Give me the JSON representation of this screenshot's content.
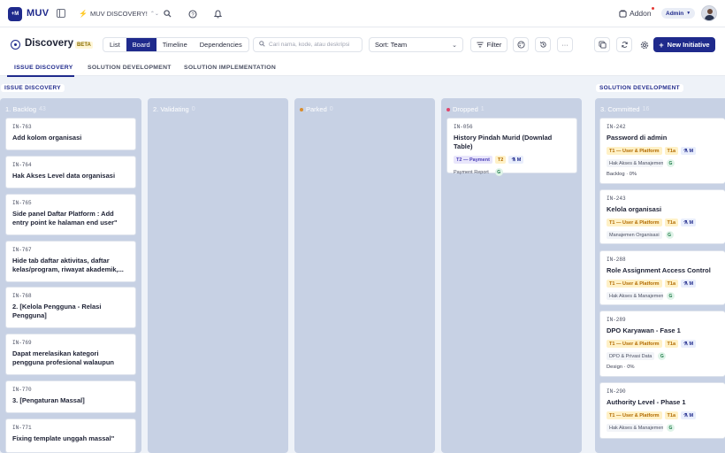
{
  "app": {
    "logo_mark": "+M",
    "logo_text": "MUV",
    "workspace": "MUV DISCOVERY!",
    "addon_label": "Addon",
    "role": "Admin"
  },
  "header": {
    "title": "Discovery",
    "badge": "BETA",
    "views": [
      "List",
      "Board",
      "Timeline",
      "Dependencies"
    ],
    "active_view": "Board",
    "search_placeholder": "Cari nama, kode, atau deskripsi",
    "sort_label": "Sort: Team",
    "filter_label": "Filter",
    "new_label": "New Initiative"
  },
  "tabs": [
    "ISSUE DISCOVERY",
    "SOLUTION DEVELOPMENT",
    "SOLUTION IMPLEMENTATION"
  ],
  "sections": {
    "issue_discovery": "ISSUE DISCOVERY",
    "solution_development": "SOLUTION DEVELOPMENT"
  },
  "columns": [
    {
      "name": "1. Backlog",
      "count": "43",
      "cards": [
        {
          "id": "IN-763",
          "title": "Add kolom organisasi"
        },
        {
          "id": "IN-764",
          "title": "Hak Akses Level data organisasi"
        },
        {
          "id": "IN-765",
          "title": "Side panel Daftar Platform : Add entry point ke halaman end user\""
        },
        {
          "id": "IN-767",
          "title": "Hide tab daftar aktivitas, daftar kelas/program, riwayat akademik,..."
        },
        {
          "id": "IN-768",
          "title": "2. [Kelola Pengguna - Relasi Pengguna]"
        },
        {
          "id": "IN-769",
          "title": "Dapat merelasikan kategori pengguna profesional walaupun didaftarkan..."
        },
        {
          "id": "IN-770",
          "title": "3. [Pengaturan Massal]"
        },
        {
          "id": "IN-771",
          "title": "Fixing template unggah massal\""
        }
      ]
    },
    {
      "name": "2. Validating",
      "count": "0",
      "cards": []
    },
    {
      "name": "Parked",
      "count": "0",
      "dot": "#d98c2b",
      "cards": []
    },
    {
      "name": "Dropped",
      "count": "1",
      "dot": "#e0446b",
      "cards": [
        {
          "id": "IN-056",
          "title": "History Pindah Murid (Downlad Table)",
          "team": "T2 — Payment",
          "code": "T2",
          "size": "M",
          "module": "Payment Report",
          "owner": "G"
        }
      ]
    },
    {
      "name": "3. Committed",
      "count": "16",
      "cards": [
        {
          "id": "IN-242",
          "title": "Password di admin",
          "team": "T1 — User & Platform",
          "code": "T1a",
          "size": "M",
          "module": "Hak Akses & Manajemen",
          "owner": "G",
          "progress": "Backlog · 0%"
        },
        {
          "id": "IN-243",
          "title": "Kelola organisasi",
          "team": "T1 — User & Platform",
          "code": "T1a",
          "size": "M",
          "module": "Manajemen Organisasi",
          "owner": "G"
        },
        {
          "id": "IN-288",
          "title": "Role Assignment Access Control",
          "team": "T1 — User & Platform",
          "code": "T1a",
          "size": "M",
          "module": "Hak Akses & Manajemen",
          "owner": "G"
        },
        {
          "id": "IN-289",
          "title": "DPO Karyawan - Fase 1",
          "team": "T1 — User & Platform",
          "code": "T1a",
          "size": "M",
          "module": "DPO & Privasi Data",
          "owner": "G",
          "progress": "Design · 0%"
        },
        {
          "id": "IN-290",
          "title": "Authority Level - Phase 1",
          "team": "T1 — User & Platform",
          "code": "T1a",
          "size": "M",
          "module": "Hak Akses & Manajemen",
          "owner": "G"
        }
      ]
    }
  ],
  "colors": {
    "brand": "#1f2a8c",
    "column_bg": "#c7d1e4",
    "page_bg": "#eef2f8"
  }
}
